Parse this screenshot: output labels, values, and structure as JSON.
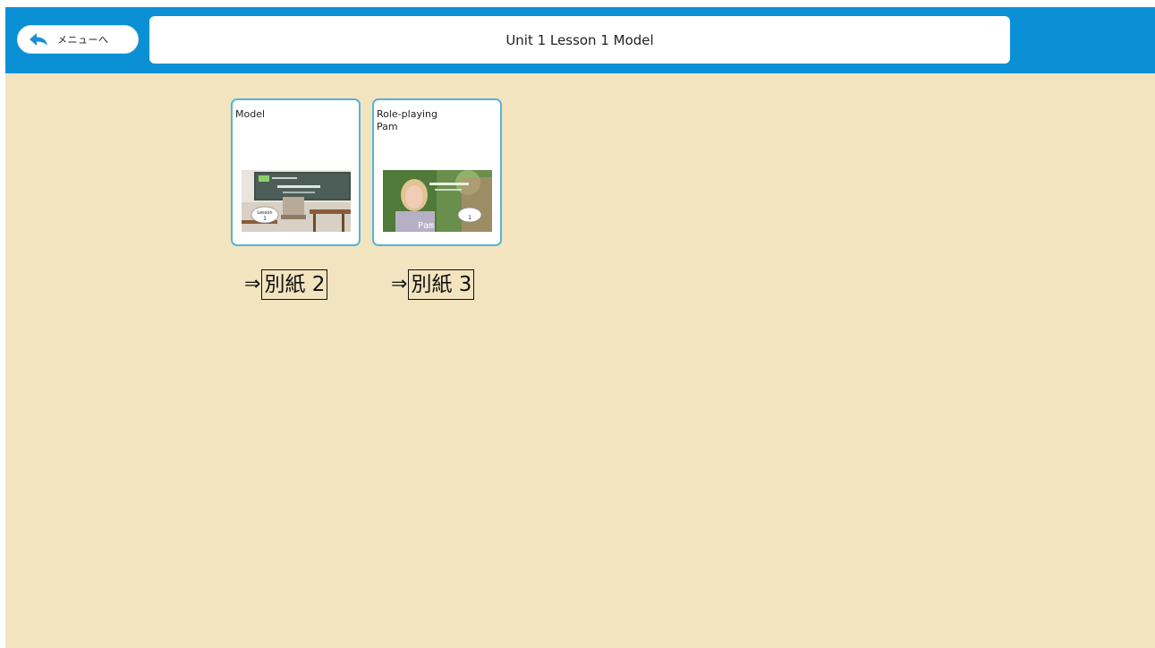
{
  "header": {
    "back_label": "メニューへ",
    "title": "Unit 1 Lesson 1 Model"
  },
  "cards": [
    {
      "title": "Model",
      "thumb_text": "Lesson",
      "thumb_number": "1",
      "reference_arrow": "⇒",
      "reference_label": "別紙 2"
    },
    {
      "title": "Role-playing\nPam",
      "thumb_text": "Pam",
      "thumb_number": "1",
      "reference_arrow": "⇒",
      "reference_label": "別紙 3"
    }
  ],
  "colors": {
    "header_bg": "#0b90d6",
    "page_bg": "#f1e4bf",
    "card_border": "#58b2dc"
  },
  "icons": {
    "back": "back-arrow-icon"
  }
}
